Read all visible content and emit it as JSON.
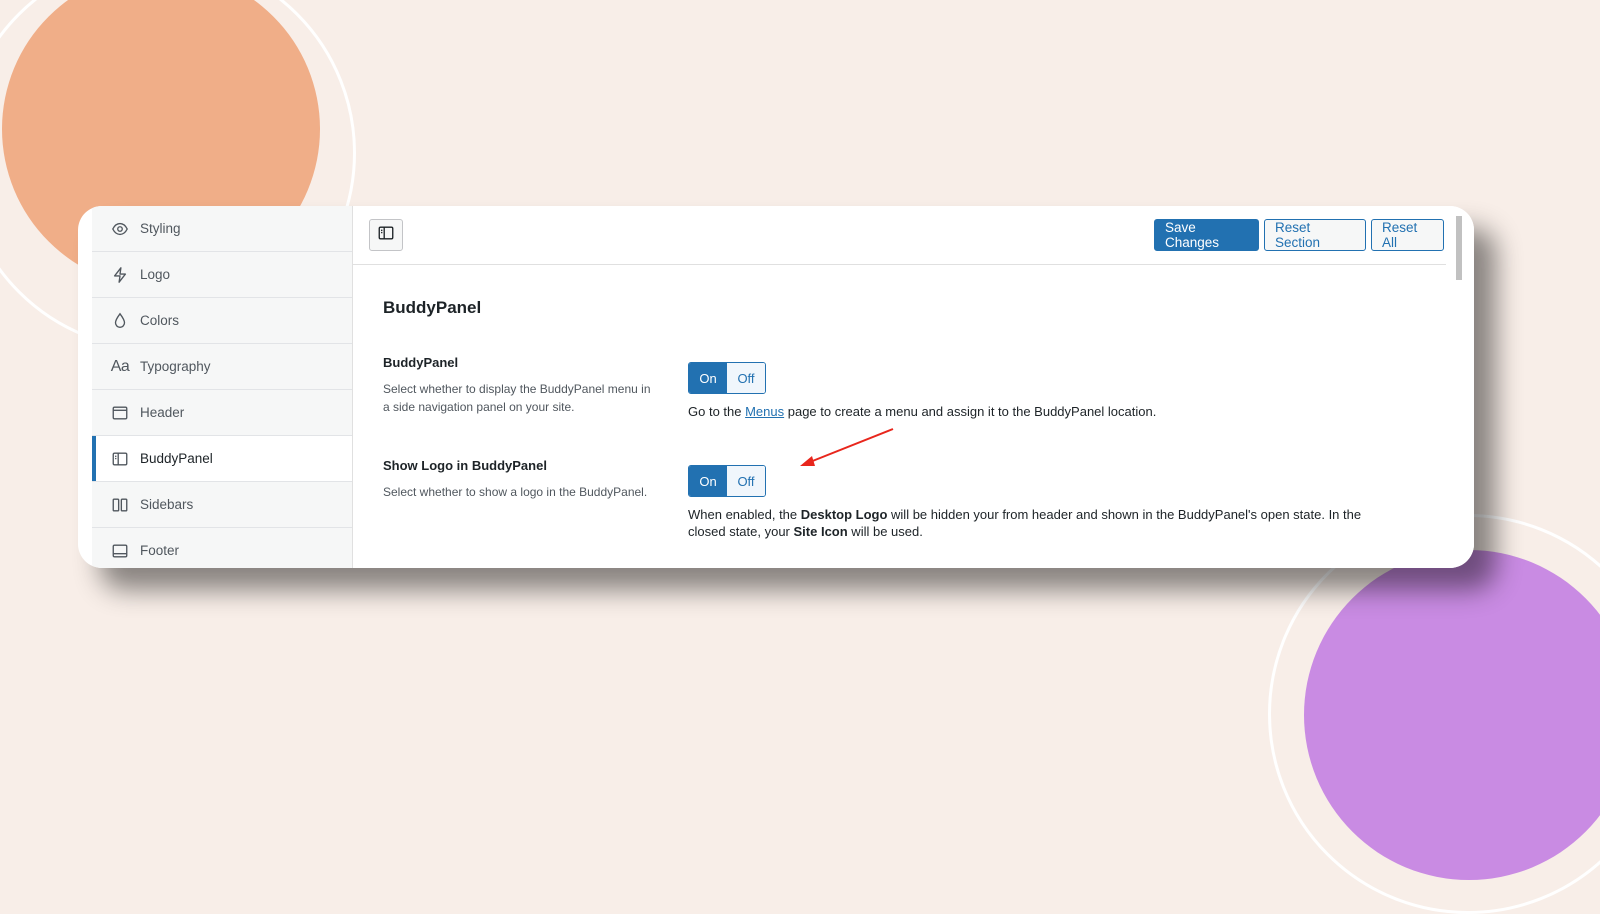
{
  "sidebar": {
    "items": [
      {
        "label": "Styling",
        "icon": "eye-icon"
      },
      {
        "label": "Logo",
        "icon": "bolt-icon"
      },
      {
        "label": "Colors",
        "icon": "droplet-icon"
      },
      {
        "label": "Typography",
        "icon": "typography-icon",
        "glyph": "Aa"
      },
      {
        "label": "Header",
        "icon": "header-layout-icon"
      },
      {
        "label": "BuddyPanel",
        "icon": "buddypanel-icon",
        "active": true
      },
      {
        "label": "Sidebars",
        "icon": "sidebars-icon"
      },
      {
        "label": "Footer",
        "icon": "footer-layout-icon"
      }
    ]
  },
  "toolbar": {
    "save_label": "Save Changes",
    "reset_section_label": "Reset Section",
    "reset_all_label": "Reset All"
  },
  "main": {
    "section_title": "BuddyPanel",
    "fields": [
      {
        "label": "BuddyPanel",
        "desc": "Select whether to display the BuddyPanel menu in a side navigation panel on your site.",
        "toggle_on": "On",
        "toggle_off": "Off",
        "note_before": "Go to the ",
        "note_link": "Menus",
        "note_after": " page to create a menu and assign it to the BuddyPanel location."
      },
      {
        "label": "Show Logo in BuddyPanel",
        "desc": "Select whether to show a logo in the BuddyPanel.",
        "toggle_on": "On",
        "toggle_off": "Off",
        "note_1": "When enabled, the ",
        "note_bold_1": "Desktop Logo",
        "note_2": " will be hidden your from header and shown in the BuddyPanel's open state. In the closed state, your ",
        "note_bold_2": "Site Icon",
        "note_3": " will be used."
      }
    ]
  },
  "colors": {
    "accent": "#2271b1",
    "annotation_arrow": "#e8261c"
  }
}
